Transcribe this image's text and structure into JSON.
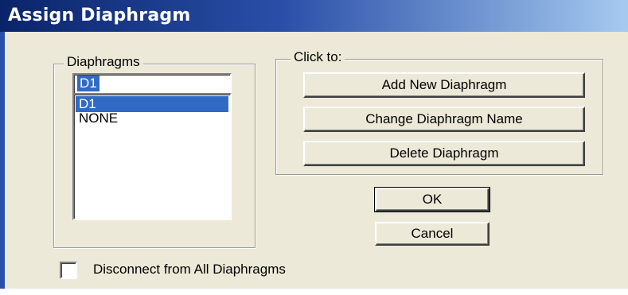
{
  "window": {
    "title": "Assign Diaphragm"
  },
  "diaphragms_group": {
    "label": "Diaphragms",
    "textbox_value": "D1",
    "list_items": [
      "D1",
      "NONE"
    ],
    "selected_index": 0
  },
  "click_to_group": {
    "label": "Click to:",
    "add_button": "Add New Diaphragm",
    "change_button": "Change Diaphragm Name",
    "delete_button": "Delete Diaphragm"
  },
  "buttons": {
    "ok": "OK",
    "cancel": "Cancel"
  },
  "disconnect_checkbox": {
    "label": "Disconnect from All Diaphragms",
    "checked": false
  },
  "colors": {
    "title_bar_start": "#0a246a",
    "title_bar_end": "#a6caf0",
    "dialog_background": "#ece9d8",
    "selection": "#316ac5"
  }
}
